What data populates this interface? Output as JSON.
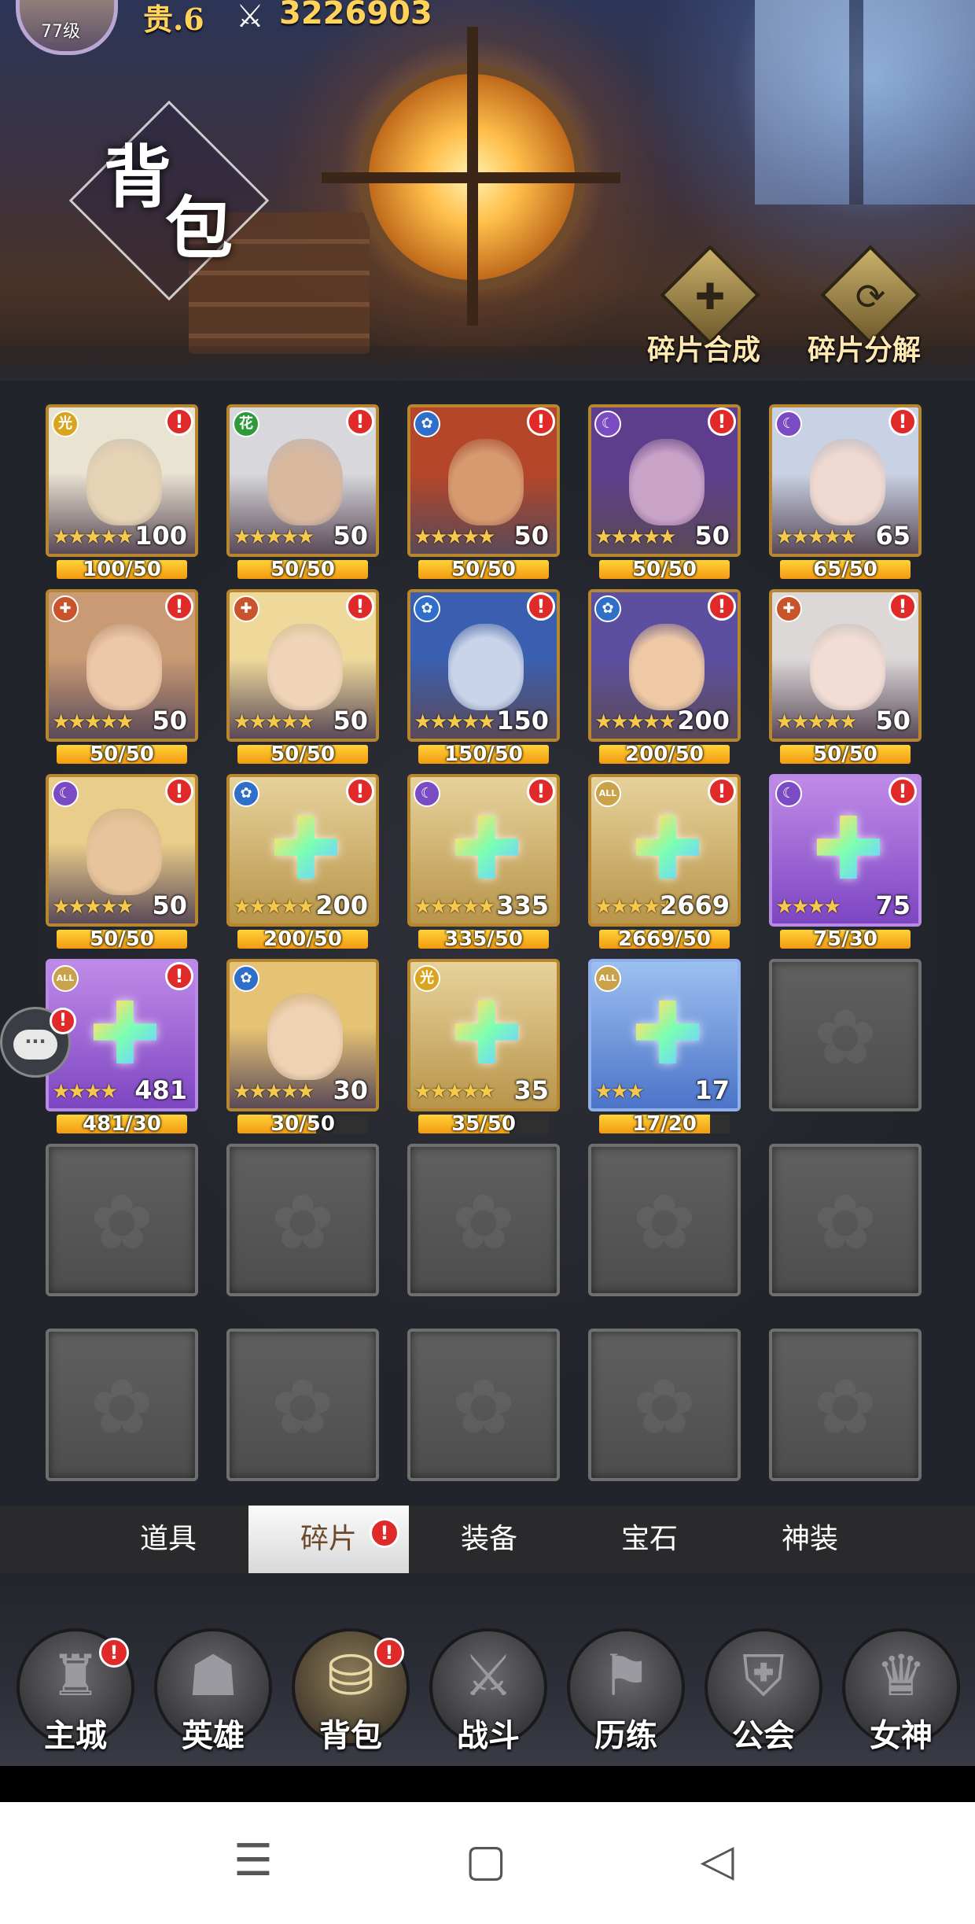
{
  "player": {
    "level": "77级",
    "vip": "贵.6",
    "power": "3226903"
  },
  "page": {
    "title_char1": "背",
    "title_char2": "包"
  },
  "actions": {
    "combine_label": "碎片合成",
    "decompose_label": "碎片分解"
  },
  "colors": {
    "alert": "#e02a2a",
    "progress_fill": "#f5b41e",
    "gold_frame": "#b8862f",
    "purple_frame": "#9a5bd6",
    "blue_frame": "#5b86d6"
  },
  "alert_mark": "!",
  "fragments": [
    {
      "kind": "hero",
      "faction": "light",
      "faction_glyph": "光",
      "stars": "★★★★★",
      "count": "100",
      "progress": "100/50",
      "ratio": 1.0,
      "alert": true,
      "skin": "#e6d2b4",
      "hair": "#e9e3d2",
      "frame": "gold"
    },
    {
      "kind": "hero",
      "faction": "nature",
      "faction_glyph": "花",
      "stars": "★★★★★",
      "count": "50",
      "progress": "50/50",
      "ratio": 1.0,
      "alert": true,
      "skin": "#d9b8a0",
      "hair": "#d8d8dc",
      "frame": "gold"
    },
    {
      "kind": "hero",
      "faction": "water",
      "faction_glyph": "✿",
      "stars": "★★★★★",
      "count": "50",
      "progress": "50/50",
      "ratio": 1.0,
      "alert": true,
      "skin": "#d79a70",
      "hair": "#b5462a",
      "frame": "gold"
    },
    {
      "kind": "hero",
      "faction": "dark",
      "faction_glyph": "☾",
      "stars": "★★★★★",
      "count": "50",
      "progress": "50/50",
      "ratio": 1.0,
      "alert": true,
      "skin": "#c9a2c8",
      "hair": "#5e3d8c",
      "frame": "gold"
    },
    {
      "kind": "hero",
      "faction": "dark",
      "faction_glyph": "☾",
      "stars": "★★★★★",
      "count": "65",
      "progress": "65/50",
      "ratio": 1.0,
      "alert": true,
      "skin": "#efd8cf",
      "hair": "#c9d2e4",
      "frame": "gold"
    },
    {
      "kind": "hero",
      "faction": "fire",
      "faction_glyph": "✚",
      "stars": "★★★★★",
      "count": "50",
      "progress": "50/50",
      "ratio": 1.0,
      "alert": true,
      "skin": "#edc8a8",
      "hair": "#c99a74",
      "frame": "gold"
    },
    {
      "kind": "hero",
      "faction": "fire",
      "faction_glyph": "✚",
      "stars": "★★★★★",
      "count": "50",
      "progress": "50/50",
      "ratio": 1.0,
      "alert": true,
      "skin": "#f0d4b8",
      "hair": "#efd99a",
      "frame": "gold"
    },
    {
      "kind": "hero",
      "faction": "water",
      "faction_glyph": "✿",
      "stars": "★★★★★",
      "count": "150",
      "progress": "150/50",
      "ratio": 1.0,
      "alert": true,
      "skin": "#c9d4ea",
      "hair": "#3b5fb0",
      "frame": "gold"
    },
    {
      "kind": "hero",
      "faction": "water",
      "faction_glyph": "✿",
      "stars": "★★★★★",
      "count": "200",
      "progress": "200/50",
      "ratio": 1.0,
      "alert": true,
      "skin": "#efc9a4",
      "hair": "#5d4fa0",
      "frame": "gold"
    },
    {
      "kind": "hero",
      "faction": "fire",
      "faction_glyph": "✚",
      "stars": "★★★★★",
      "count": "50",
      "progress": "50/50",
      "ratio": 1.0,
      "alert": true,
      "skin": "#f1ddd4",
      "hair": "#dcd8d8",
      "frame": "gold"
    },
    {
      "kind": "hero",
      "faction": "dark",
      "faction_glyph": "☾",
      "stars": "★★★★★",
      "count": "50",
      "progress": "50/50",
      "ratio": 1.0,
      "alert": true,
      "skin": "#e8c49c",
      "hair": "#e9cd8a",
      "frame": "gold"
    },
    {
      "kind": "puzzle",
      "faction": "water",
      "faction_glyph": "✿",
      "stars": "★★★★★",
      "count": "200",
      "progress": "200/50",
      "ratio": 1.0,
      "alert": true,
      "frame": "gold"
    },
    {
      "kind": "puzzle",
      "faction": "dark",
      "faction_glyph": "☾",
      "stars": "★★★★★",
      "count": "335",
      "progress": "335/50",
      "ratio": 1.0,
      "alert": true,
      "frame": "gold"
    },
    {
      "kind": "puzzle",
      "faction": "all",
      "faction_glyph": "ALL",
      "stars": "★★★★★",
      "count": "2669",
      "progress": "2669/50",
      "ratio": 1.0,
      "alert": true,
      "frame": "gold"
    },
    {
      "kind": "puzzle",
      "faction": "dark",
      "faction_glyph": "☾",
      "stars": "★★★★",
      "count": "75",
      "progress": "75/30",
      "ratio": 1.0,
      "alert": true,
      "frame": "purple"
    },
    {
      "kind": "puzzle",
      "faction": "all",
      "faction_glyph": "ALL",
      "stars": "★★★★",
      "count": "481",
      "progress": "481/30",
      "ratio": 1.0,
      "alert": true,
      "frame": "purple"
    },
    {
      "kind": "hero",
      "faction": "water",
      "faction_glyph": "✿",
      "stars": "★★★★★",
      "count": "30",
      "progress": "30/50",
      "ratio": 0.6,
      "alert": false,
      "skin": "#efd2b4",
      "hair": "#e6c274",
      "frame": "gold"
    },
    {
      "kind": "puzzle",
      "faction": "light",
      "faction_glyph": "光",
      "stars": "★★★★★",
      "count": "35",
      "progress": "35/50",
      "ratio": 0.7,
      "alert": false,
      "frame": "gold"
    },
    {
      "kind": "puzzle",
      "faction": "all",
      "faction_glyph": "ALL",
      "stars": "★★★",
      "count": "17",
      "progress": "17/20",
      "ratio": 0.85,
      "alert": false,
      "frame": "blue"
    },
    {
      "kind": "empty"
    },
    {
      "kind": "empty"
    },
    {
      "kind": "empty"
    },
    {
      "kind": "empty"
    },
    {
      "kind": "empty"
    },
    {
      "kind": "empty"
    },
    {
      "kind": "empty"
    },
    {
      "kind": "empty"
    },
    {
      "kind": "empty"
    },
    {
      "kind": "empty"
    },
    {
      "kind": "empty"
    }
  ],
  "tabs": [
    {
      "label": "道具",
      "active": false,
      "alert": false
    },
    {
      "label": "碎片",
      "active": true,
      "alert": true
    },
    {
      "label": "装备",
      "active": false,
      "alert": false
    },
    {
      "label": "宝石",
      "active": false,
      "alert": false
    },
    {
      "label": "神装",
      "active": false,
      "alert": false
    }
  ],
  "nav": [
    {
      "label": "主城",
      "icon": "castle-icon",
      "glyph": "♜",
      "alert": true,
      "active": false
    },
    {
      "label": "英雄",
      "icon": "hooded-hero-icon",
      "glyph": "☗",
      "alert": false,
      "active": false
    },
    {
      "label": "背包",
      "icon": "backpack-icon",
      "glyph": "⛁",
      "alert": true,
      "active": true
    },
    {
      "label": "战斗",
      "icon": "crossed-swords-icon",
      "glyph": "⚔",
      "alert": false,
      "active": false
    },
    {
      "label": "历练",
      "icon": "map-icon",
      "glyph": "⚑",
      "alert": false,
      "active": false
    },
    {
      "label": "公会",
      "icon": "shield-icon",
      "glyph": "⛨",
      "alert": false,
      "active": false
    },
    {
      "label": "女神",
      "icon": "goddess-icon",
      "glyph": "♛",
      "alert": false,
      "active": false
    }
  ],
  "system_nav": {
    "menu_icon": "☰",
    "home_icon": "▢",
    "back_icon": "◁"
  }
}
